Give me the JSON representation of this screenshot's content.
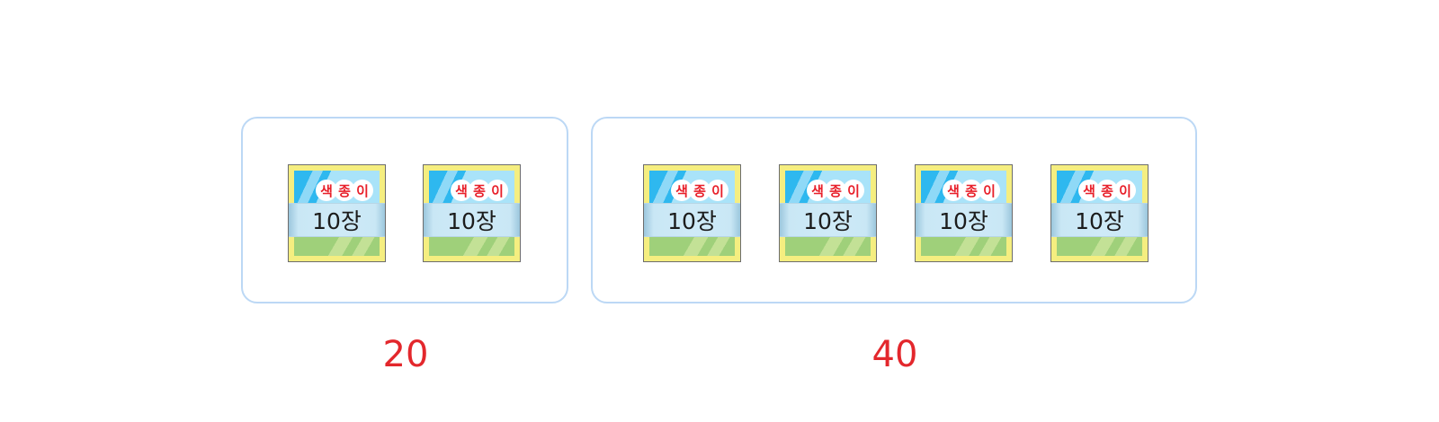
{
  "groups": [
    {
      "total_label": "20",
      "packs": [
        {
          "brand": [
            "색",
            "종",
            "이"
          ],
          "count_label": "10장"
        },
        {
          "brand": [
            "색",
            "종",
            "이"
          ],
          "count_label": "10장"
        }
      ]
    },
    {
      "total_label": "40",
      "packs": [
        {
          "brand": [
            "색",
            "종",
            "이"
          ],
          "count_label": "10장"
        },
        {
          "brand": [
            "색",
            "종",
            "이"
          ],
          "count_label": "10장"
        },
        {
          "brand": [
            "색",
            "종",
            "이"
          ],
          "count_label": "10장"
        },
        {
          "brand": [
            "색",
            "종",
            "이"
          ],
          "count_label": "10장"
        }
      ]
    }
  ],
  "colors": {
    "box_border": "#bcd8f5",
    "label_red": "#e3272c",
    "pack_frame": "#f5ee80",
    "pack_sky": "#2eb8ef",
    "pack_grass": "#9fd07a"
  }
}
